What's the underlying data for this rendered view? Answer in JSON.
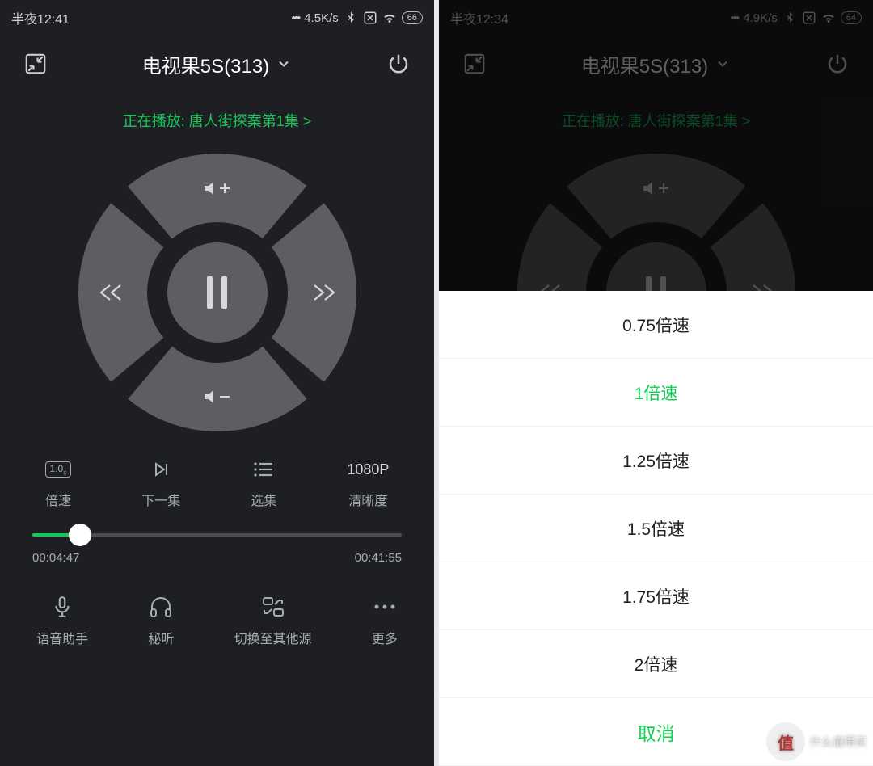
{
  "left": {
    "status": {
      "time": "半夜12:41",
      "net": "4.5K/s",
      "battery": "66"
    },
    "header": {
      "title": "电视果5S(313)"
    },
    "now_playing": "正在播放: 唐人街探案第1集 >",
    "controls": {
      "speed_label": "倍速",
      "next_label": "下一集",
      "episodes_label": "选集",
      "quality_value": "1080P",
      "quality_label": "清晰度",
      "speed_icon_value": "1.0"
    },
    "progress": {
      "current": "00:04:47",
      "total": "00:41:55",
      "percent": 13
    },
    "bottom": {
      "voice_label": "语音助手",
      "listen_label": "秘听",
      "switch_label": "切换至其他源",
      "more_label": "更多"
    }
  },
  "right": {
    "status": {
      "time": "半夜12:34",
      "net": "4.9K/s",
      "battery": "64"
    },
    "header": {
      "title": "电视果5S(313)"
    },
    "now_playing": "正在播放: 唐人街探案第1集 >",
    "speed_options": [
      "0.75倍速",
      "1倍速",
      "1.25倍速",
      "1.5倍速",
      "1.75倍速",
      "2倍速"
    ],
    "speed_selected_index": 1,
    "cancel_label": "取消"
  },
  "watermark": {
    "badge": "值",
    "text": "什么值得买"
  }
}
